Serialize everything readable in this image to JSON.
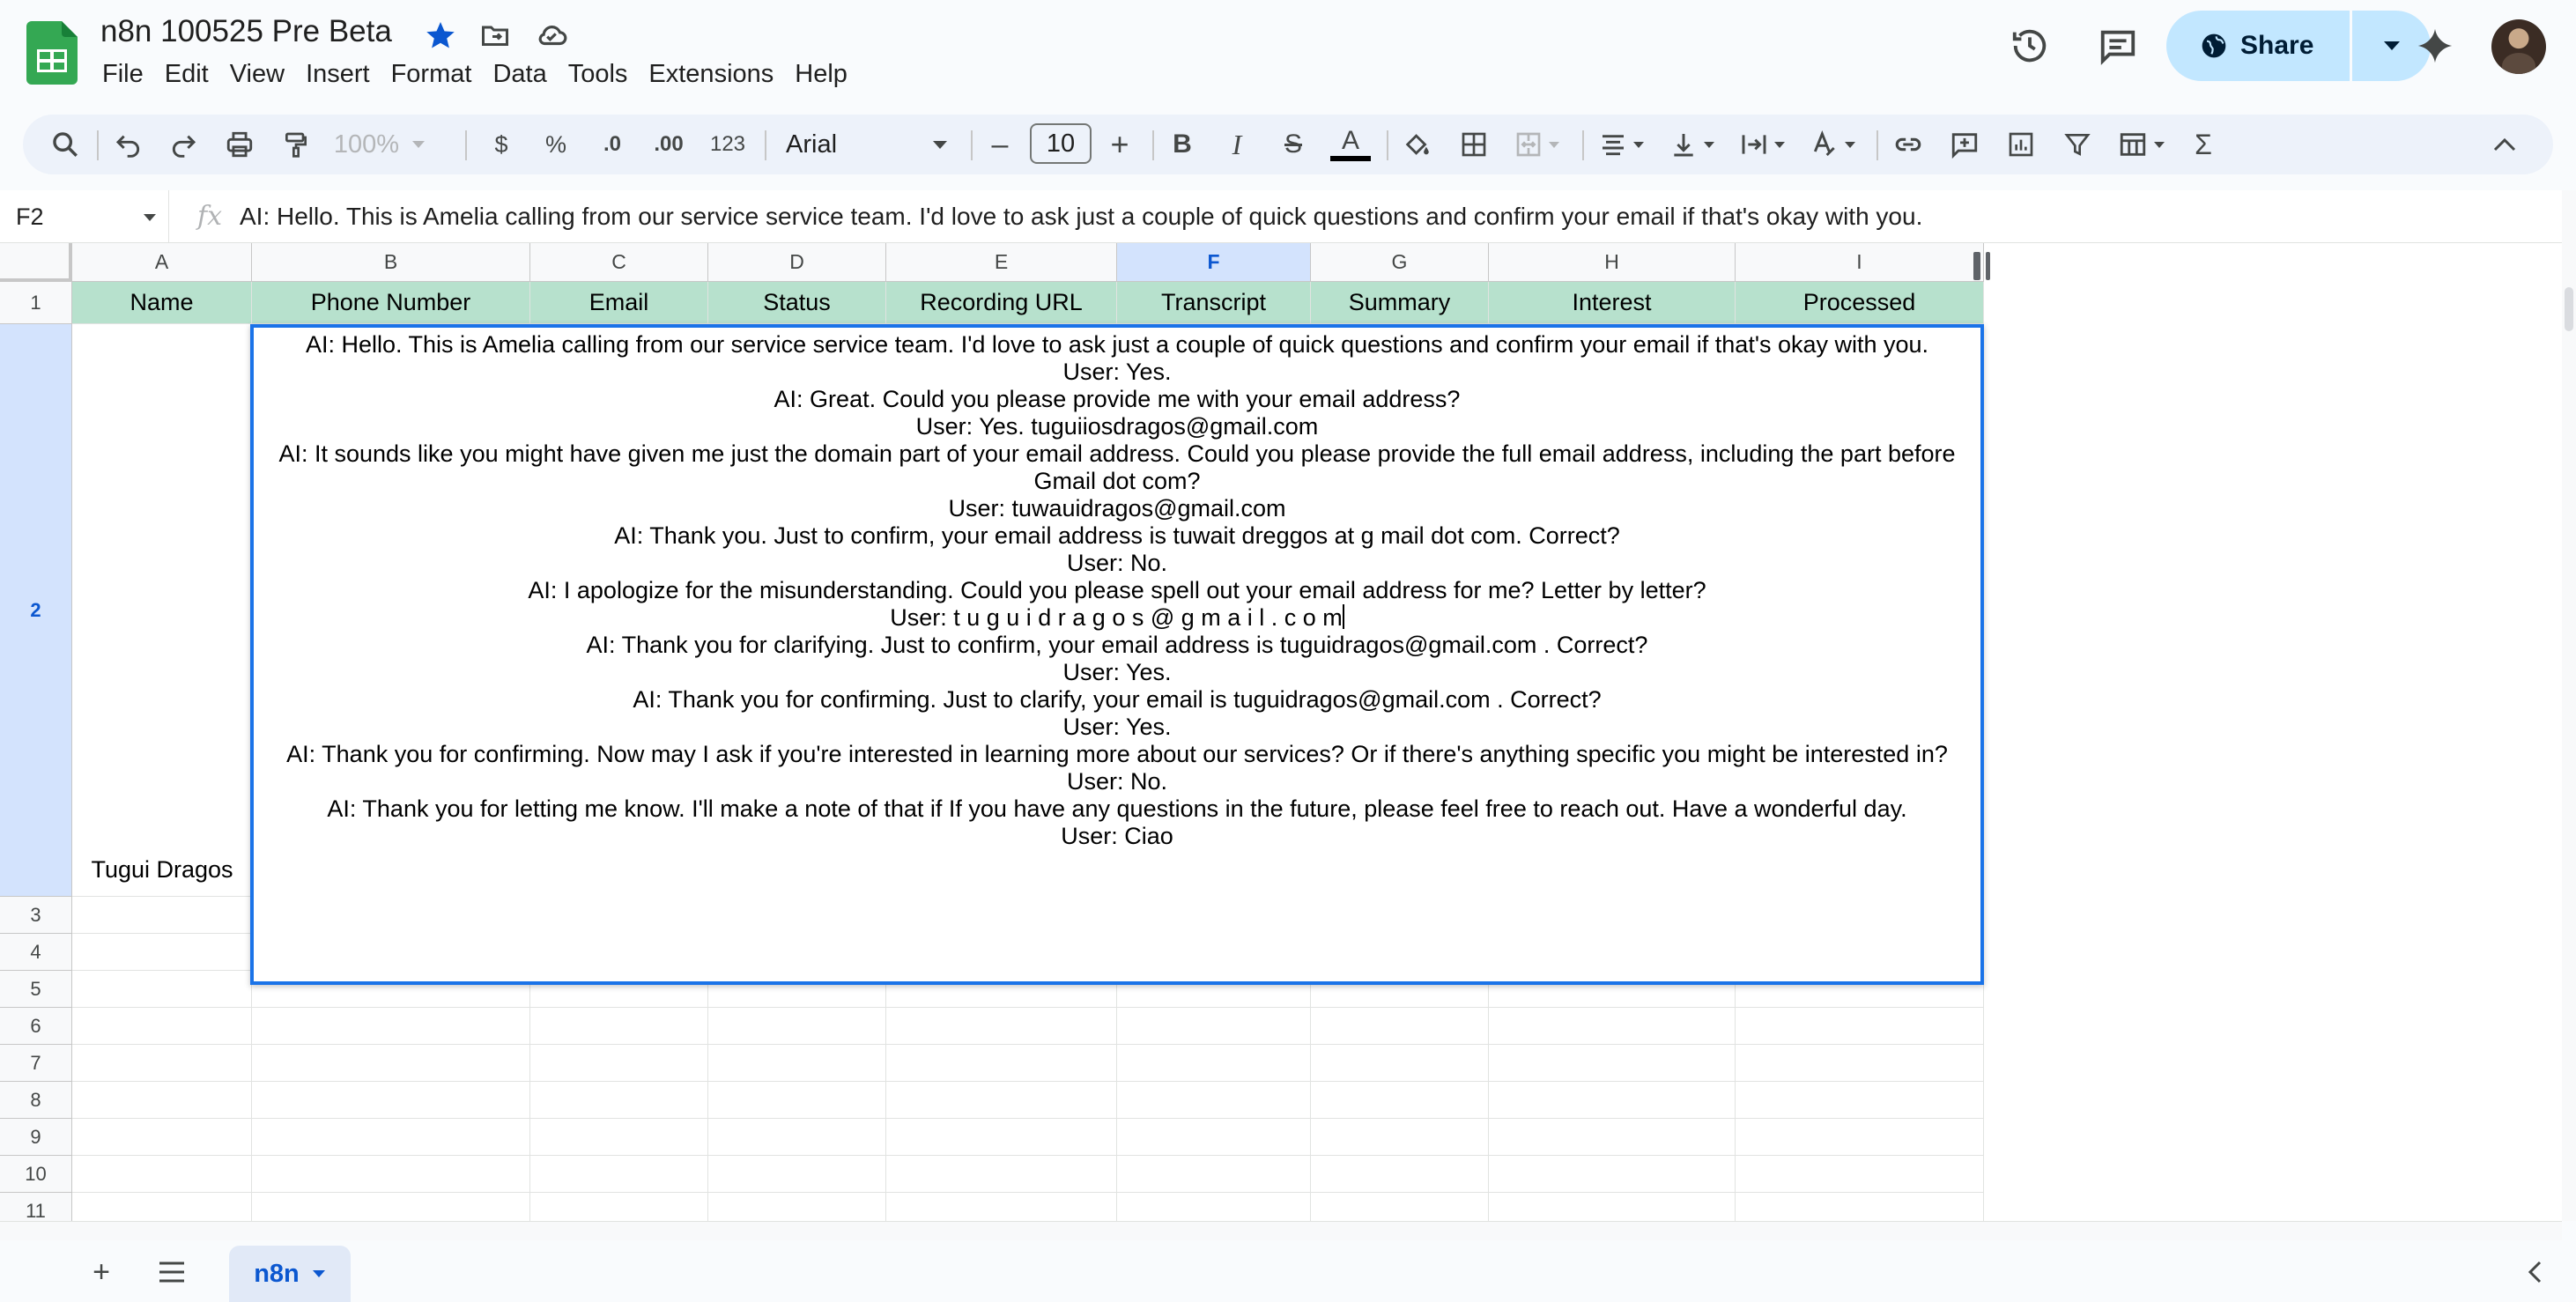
{
  "doc": {
    "title": "n8n 100525 Pre Beta"
  },
  "menu": [
    "File",
    "Edit",
    "View",
    "Insert",
    "Format",
    "Data",
    "Tools",
    "Extensions",
    "Help"
  ],
  "share": {
    "label": "Share"
  },
  "toolbar": {
    "zoom": "100%",
    "currency": "$",
    "percent": "%",
    "dec_decrease": ".0",
    "dec_increase": ".00",
    "number_format": "123",
    "font": "Arial",
    "font_size": "10",
    "minus": "–",
    "plus": "+",
    "bold": "B",
    "italic": "I",
    "strike": "S",
    "text_color": "A",
    "sigma": "Σ"
  },
  "formula_bar": {
    "cell_ref": "F2",
    "fx": "fx",
    "content": "AI: Hello. This is Amelia calling from our service service team. I'd love to ask just a couple of quick questions and confirm your email if that's okay with you."
  },
  "grid": {
    "columns": [
      "A",
      "B",
      "C",
      "D",
      "E",
      "F",
      "G",
      "H",
      "I"
    ],
    "selected_column": "F",
    "rows": [
      "1",
      "2",
      "3",
      "4",
      "5",
      "6",
      "7",
      "8",
      "9",
      "10",
      "11"
    ],
    "selected_row": "2",
    "header_row": [
      "Name",
      "Phone Number",
      "Email",
      "Status",
      "Recording URL",
      "Transcript",
      "Summary",
      "Interest",
      "Processed"
    ],
    "a2": "Tugui Dragos",
    "header_fill": "#b7e1cd",
    "selection_color": "#1a73e8"
  },
  "editor": {
    "lines": [
      "AI: Hello. This is Amelia calling from our service service team. I'd love to ask just a couple of quick questions and confirm your email if that's okay with you.",
      "User: Yes.",
      "AI: Great. Could you please provide me with your email address?",
      "User: Yes. tuguiiosdragos@gmail.com",
      "AI: It sounds like you might have given me just the domain part of your email address. Could you please provide the full email address, including the part before Gmail dot com?",
      "User: tuwauidragos@gmail.com",
      "AI: Thank you. Just to confirm, your email address is tuwait dreggos at g mail dot com. Correct?",
      "User: No.",
      "AI: I apologize for the misunderstanding. Could you please spell out your email address for me? Letter by letter?",
      "User: t u g u i d r a g o s @ g m a i l . c o m",
      "AI: Thank you for clarifying. Just to confirm, your email address is tuguidragos@gmail.com . Correct?",
      "User: Yes.",
      "AI: Thank you for confirming. Just to clarify, your email is tuguidragos@gmail.com . Correct?",
      "User: Yes.",
      "AI: Thank you for confirming. Now may I ask if you're interested in learning more about our services? Or if there's anything specific you might be interested in?",
      "User: No.",
      "AI: Thank you for letting me know. I'll make a note of that if If you have any questions in the future, please feel free to reach out. Have a wonderful day.",
      "User: Ciao"
    ]
  },
  "sheets": {
    "active": "n8n"
  },
  "icons": [
    "sheets-logo",
    "star-icon",
    "move-folder-icon",
    "cloud-icon",
    "history-icon",
    "comment-icon",
    "globe-icon",
    "sparkle-icon",
    "search-icon",
    "undo-icon",
    "redo-icon",
    "print-icon",
    "paint-format-icon",
    "chevron-up-icon"
  ]
}
